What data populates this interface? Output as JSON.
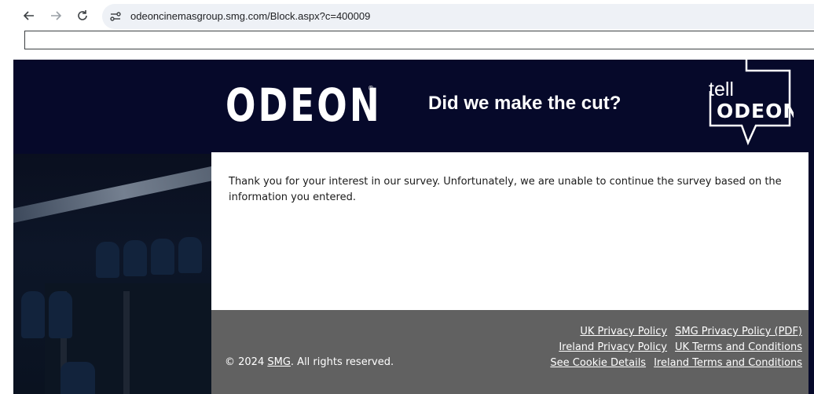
{
  "browser": {
    "url": "odeoncinemasgroup.smg.com/Block.aspx?c=400009",
    "icons": [
      "back-arrow-icon",
      "forward-arrow-icon",
      "reload-icon",
      "site-settings-icon"
    ]
  },
  "header": {
    "brand": "ODEON",
    "brand_mark": "®",
    "tagline": "Did we make the cut?",
    "tell_logo_top": "tell",
    "tell_logo_bottom": "ODEON"
  },
  "main": {
    "message": "Thank you for your interest in our survey. Unfortunately, we are unable to continue the survey based on the information you entered."
  },
  "footer": {
    "copyright_prefix": "© 2024 ",
    "copyright_link": "SMG",
    "copyright_suffix": ". All rights reserved.",
    "links": {
      "uk_privacy": "UK Privacy Policy",
      "smg_privacy": "SMG Privacy Policy (PDF)",
      "ireland_privacy": "Ireland Privacy Policy",
      "uk_terms": "UK Terms and Conditions",
      "cookie_details": "See Cookie Details",
      "ireland_terms": "Ireland Terms and Conditions"
    }
  },
  "colors": {
    "header_bg": "#06092a",
    "footer_bg": "#616161",
    "content_bg": "#ffffff"
  }
}
